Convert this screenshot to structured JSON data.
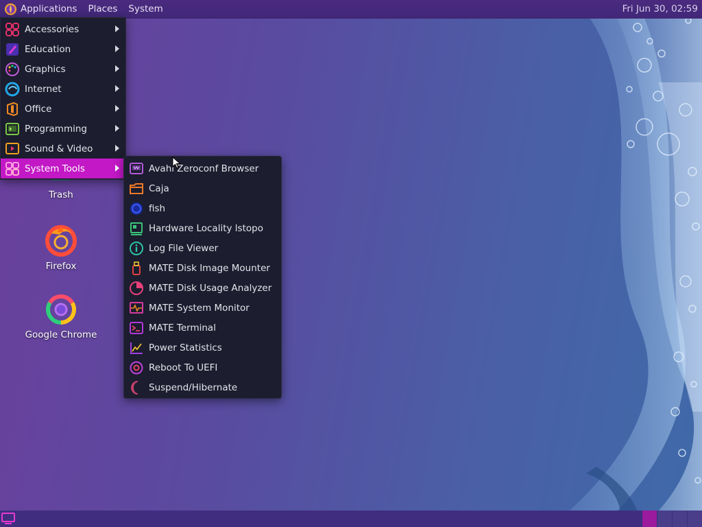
{
  "top_panel": {
    "menus": [
      {
        "label": "Applications",
        "icon": "mate-logo-icon"
      },
      {
        "label": "Places"
      },
      {
        "label": "System"
      }
    ],
    "clock": "Fri Jun 30, 02:59"
  },
  "applications_menu": {
    "items": [
      {
        "label": "Accessories",
        "icon": "accessories-icon",
        "color": "#e8306a"
      },
      {
        "label": "Education",
        "icon": "education-icon",
        "color": "#8a4df0"
      },
      {
        "label": "Graphics",
        "icon": "graphics-icon",
        "color": "#c05ad8"
      },
      {
        "label": "Internet",
        "icon": "internet-icon",
        "color": "#21a8e8"
      },
      {
        "label": "Office",
        "icon": "office-icon",
        "color": "#f08a24"
      },
      {
        "label": "Programming",
        "icon": "programming-icon",
        "color": "#7ac943"
      },
      {
        "label": "Sound & Video",
        "icon": "sound-video-icon",
        "color": "#f0a020"
      },
      {
        "label": "System Tools",
        "icon": "system-tools-icon",
        "color": "#ff7fd0",
        "selected": true
      }
    ]
  },
  "system_tools_menu": {
    "items": [
      {
        "label": "Avahi Zeroconf Browser",
        "icon": "avahi-icon",
        "color": "#b25ad8"
      },
      {
        "label": "Caja",
        "icon": "folder-icon",
        "color": "#f07a28"
      },
      {
        "label": "fish",
        "icon": "fish-icon",
        "color": "#2a4fd6"
      },
      {
        "label": "Hardware Locality lstopo",
        "icon": "hardware-icon",
        "color": "#3ac47a"
      },
      {
        "label": "Log File Viewer",
        "icon": "info-icon",
        "color": "#2ec4a0"
      },
      {
        "label": "MATE Disk Image Mounter",
        "icon": "usb-drive-icon",
        "color": "#e04040"
      },
      {
        "label": "MATE Disk Usage Analyzer",
        "icon": "pie-chart-icon",
        "color": "#e8407a"
      },
      {
        "label": "MATE System Monitor",
        "icon": "system-monitor-icon",
        "color": "#d83aa0"
      },
      {
        "label": "MATE Terminal",
        "icon": "terminal-icon",
        "color": "#b03ad8"
      },
      {
        "label": "Power Statistics",
        "icon": "power-stats-icon",
        "color": "#a040e0"
      },
      {
        "label": "Reboot To UEFI",
        "icon": "reboot-icon",
        "color": "#c040e0"
      },
      {
        "label": "Suspend/Hibernate",
        "icon": "moon-icon",
        "color": "#c0406a"
      }
    ]
  },
  "desktop_icons": [
    {
      "label": "Trash",
      "icon": "trash-icon"
    },
    {
      "label": "Firefox",
      "icon": "firefox-icon"
    },
    {
      "label": "Google Chrome",
      "icon": "chrome-icon"
    }
  ],
  "bottom_panel": {
    "show_desktop_icon": "show-desktop-icon",
    "workspaces": 4,
    "active_workspace": 1
  }
}
